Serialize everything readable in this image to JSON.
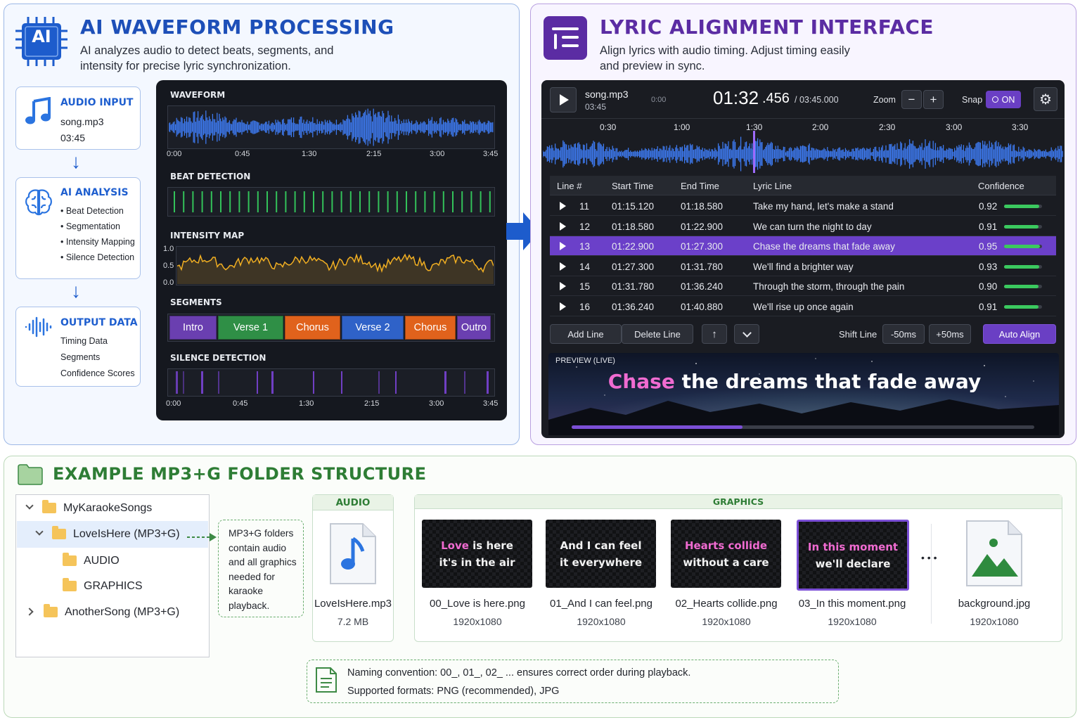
{
  "waveform_panel": {
    "title": "AI WAVEFORM PROCESSING",
    "subtitle_line1": "AI analyzes audio to detect beats, segments, and",
    "subtitle_line2": "intensity for precise lyric synchronization.",
    "chip_label": "AI",
    "audio_input": {
      "title": "AUDIO INPUT",
      "file": "song.mp3",
      "duration": "03:45"
    },
    "ai_analysis": {
      "title": "AI ANALYSIS",
      "items": [
        "• Beat Detection",
        "• Segmentation",
        "• Intensity Mapping",
        "• Silence Detection"
      ]
    },
    "output_data": {
      "title": "OUTPUT DATA",
      "items": [
        "Timing Data",
        "Segments",
        "Confidence Scores"
      ]
    },
    "sections": {
      "waveform": "WAVEFORM",
      "beat": "BEAT DETECTION",
      "intensity": "INTENSITY MAP",
      "segments": "SEGMENTS",
      "silence": "SILENCE DETECTION"
    },
    "time_ticks": [
      "0:00",
      "0:45",
      "1:30",
      "2:15",
      "3:00",
      "3:45"
    ],
    "intensity_ticks": [
      "1.0",
      "0.5",
      "0.0"
    ],
    "segments": [
      {
        "label": "Intro",
        "color": "#6a3fb0"
      },
      {
        "label": "Verse 1",
        "color": "#2f8f46"
      },
      {
        "label": "Chorus",
        "color": "#e0621c"
      },
      {
        "label": "Verse 2",
        "color": "#2f62c8"
      },
      {
        "label": "Chorus",
        "color": "#e0621c"
      },
      {
        "label": "Outro",
        "color": "#6a3fb0"
      }
    ]
  },
  "lyric_panel": {
    "title": "LYRIC ALIGNMENT INTERFACE",
    "subtitle_line1": "Align lyrics with audio timing. Adjust timing easily",
    "subtitle_line2": "and preview in sync.",
    "toolbar": {
      "file": "song.mp3",
      "file_duration": "03:45",
      "small_time": "0:00",
      "time_main": "01:32",
      "time_ms": ".456",
      "time_total": "/ 03:45.000",
      "zoom_label": "Zoom",
      "zoom_minus": "−",
      "zoom_plus": "+",
      "snap_label": "Snap",
      "snap_state": "ON"
    },
    "ruler": [
      "0:30",
      "1:00",
      "1:30",
      "2:00",
      "2:30",
      "3:00",
      "3:30"
    ],
    "table": {
      "headers": [
        "Line #",
        "Start Time",
        "End Time",
        "Lyric Line",
        "Confidence"
      ],
      "rows": [
        {
          "line": "11",
          "start": "01:15.120",
          "end": "01:18.580",
          "lyric": "Take my hand, let's make a stand",
          "conf": "0.92",
          "v": 0.92
        },
        {
          "line": "12",
          "start": "01:18.580",
          "end": "01:22.900",
          "lyric": "We can turn the night to day",
          "conf": "0.91",
          "v": 0.91
        },
        {
          "line": "13",
          "start": "01:22.900",
          "end": "01:27.300",
          "lyric": "Chase the dreams that fade away",
          "conf": "0.95",
          "v": 0.95
        },
        {
          "line": "14",
          "start": "01:27.300",
          "end": "01:31.780",
          "lyric": "We'll find a brighter way",
          "conf": "0.93",
          "v": 0.93
        },
        {
          "line": "15",
          "start": "01:31.780",
          "end": "01:36.240",
          "lyric": "Through the storm, through the pain",
          "conf": "0.90",
          "v": 0.9
        },
        {
          "line": "16",
          "start": "01:36.240",
          "end": "01:40.880",
          "lyric": "We'll rise up once again",
          "conf": "0.91",
          "v": 0.91
        }
      ]
    },
    "actions": {
      "add": "Add Line",
      "delete": "Delete Line",
      "shift_label": "Shift Line",
      "minus": "-50ms",
      "plus": "+50ms",
      "auto": "Auto Align"
    },
    "preview": {
      "label": "PREVIEW (LIVE)",
      "highlight": "Chase",
      "rest": " the dreams that fade away",
      "progress": 0.37
    }
  },
  "folder_panel": {
    "title": "EXAMPLE MP3+G FOLDER STRUCTURE",
    "tree": {
      "root": "MyKaraokeSongs",
      "song": "LoveIsHere (MP3+G)",
      "audio": "AUDIO",
      "graphics": "GRAPHICS",
      "other": "AnotherSong (MP3+G)"
    },
    "note": [
      "MP3+G folders",
      "contain audio",
      "and all graphics",
      "needed for",
      "karaoke",
      "playback."
    ],
    "audio_header": "AUDIO",
    "audio_file": {
      "name": "LoveIsHere.mp3",
      "size": "7.2 MB"
    },
    "graphics_header": "GRAPHICS",
    "graphics": [
      {
        "line1_hl": "Love",
        "line1_rest": " is here",
        "line2": "it's in the air",
        "name": "00_Love is here.png",
        "dim": "1920x1080"
      },
      {
        "line1_hl": "",
        "line1_rest": "And I can feel",
        "line2": "it everywhere",
        "name": "01_And I can feel.png",
        "dim": "1920x1080"
      },
      {
        "line1_hl": "Hearts collide",
        "line1_rest": "",
        "line2": "without a care",
        "name": "02_Hearts collide.png",
        "dim": "1920x1080"
      },
      {
        "line1_hl": "In this moment",
        "line1_rest": "",
        "line2": "we'll declare",
        "name": "03_In this moment.png",
        "dim": "1920x1080"
      }
    ],
    "ellipsis": "• • •",
    "background": {
      "name": "background.jpg",
      "dim": "1920x1080"
    },
    "naming_line1": "Naming convention: 00_, 01_, 02_ ... ensures correct order during playback.",
    "naming_line2": "Supported formats: PNG (recommended), JPG"
  }
}
